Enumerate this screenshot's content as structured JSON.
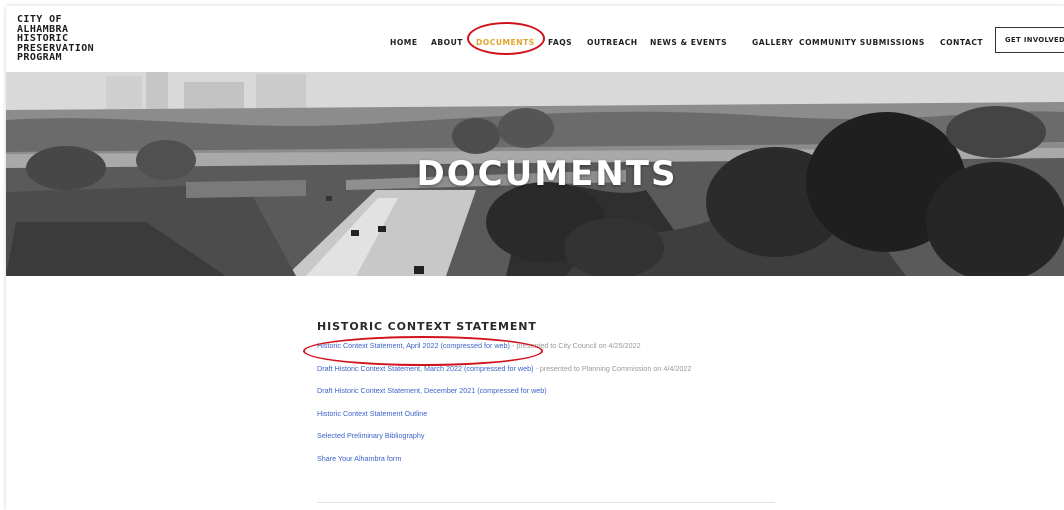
{
  "site": {
    "logo_lines": [
      "CITY OF",
      "ALHAMBRA",
      "HISTORIC",
      "PRESERVATION",
      "PROGRAM"
    ]
  },
  "nav": {
    "items": [
      {
        "label": "HOME"
      },
      {
        "label": "ABOUT"
      },
      {
        "label": "DOCUMENTS",
        "active": true
      },
      {
        "label": "FAQS"
      },
      {
        "label": "OUTREACH"
      },
      {
        "label": "NEWS & EVENTS"
      },
      {
        "label": "GALLERY"
      },
      {
        "label": "COMMUNITY SUBMISSIONS"
      },
      {
        "label": "CONTACT"
      }
    ],
    "cta_label": "GET INVOLVED"
  },
  "hero": {
    "title": "DOCUMENTS"
  },
  "section": {
    "title": "HISTORIC CONTEXT STATEMENT",
    "documents": [
      {
        "link": "Historic Context Statement, April 2022 (compressed for web)",
        "note": " - presented to City Council on 4/25/2022"
      },
      {
        "link": "Draft Historic Context Statement, March 2022 (compressed for web)",
        "note": " - presented to Planning Commission on 4/4/2022"
      },
      {
        "link": "Draft Historic Context Statement, December 2021 (compressed for web)",
        "note": ""
      },
      {
        "link": "Historic Context Statement Outline",
        "note": ""
      },
      {
        "link": "Selected Preliminary Bibliography",
        "note": ""
      },
      {
        "link": "Share Your Alhambra form",
        "note": ""
      }
    ]
  },
  "colors": {
    "active_nav": "#e0a52a",
    "link": "#3d63c9",
    "annotation": "#d0121b"
  }
}
